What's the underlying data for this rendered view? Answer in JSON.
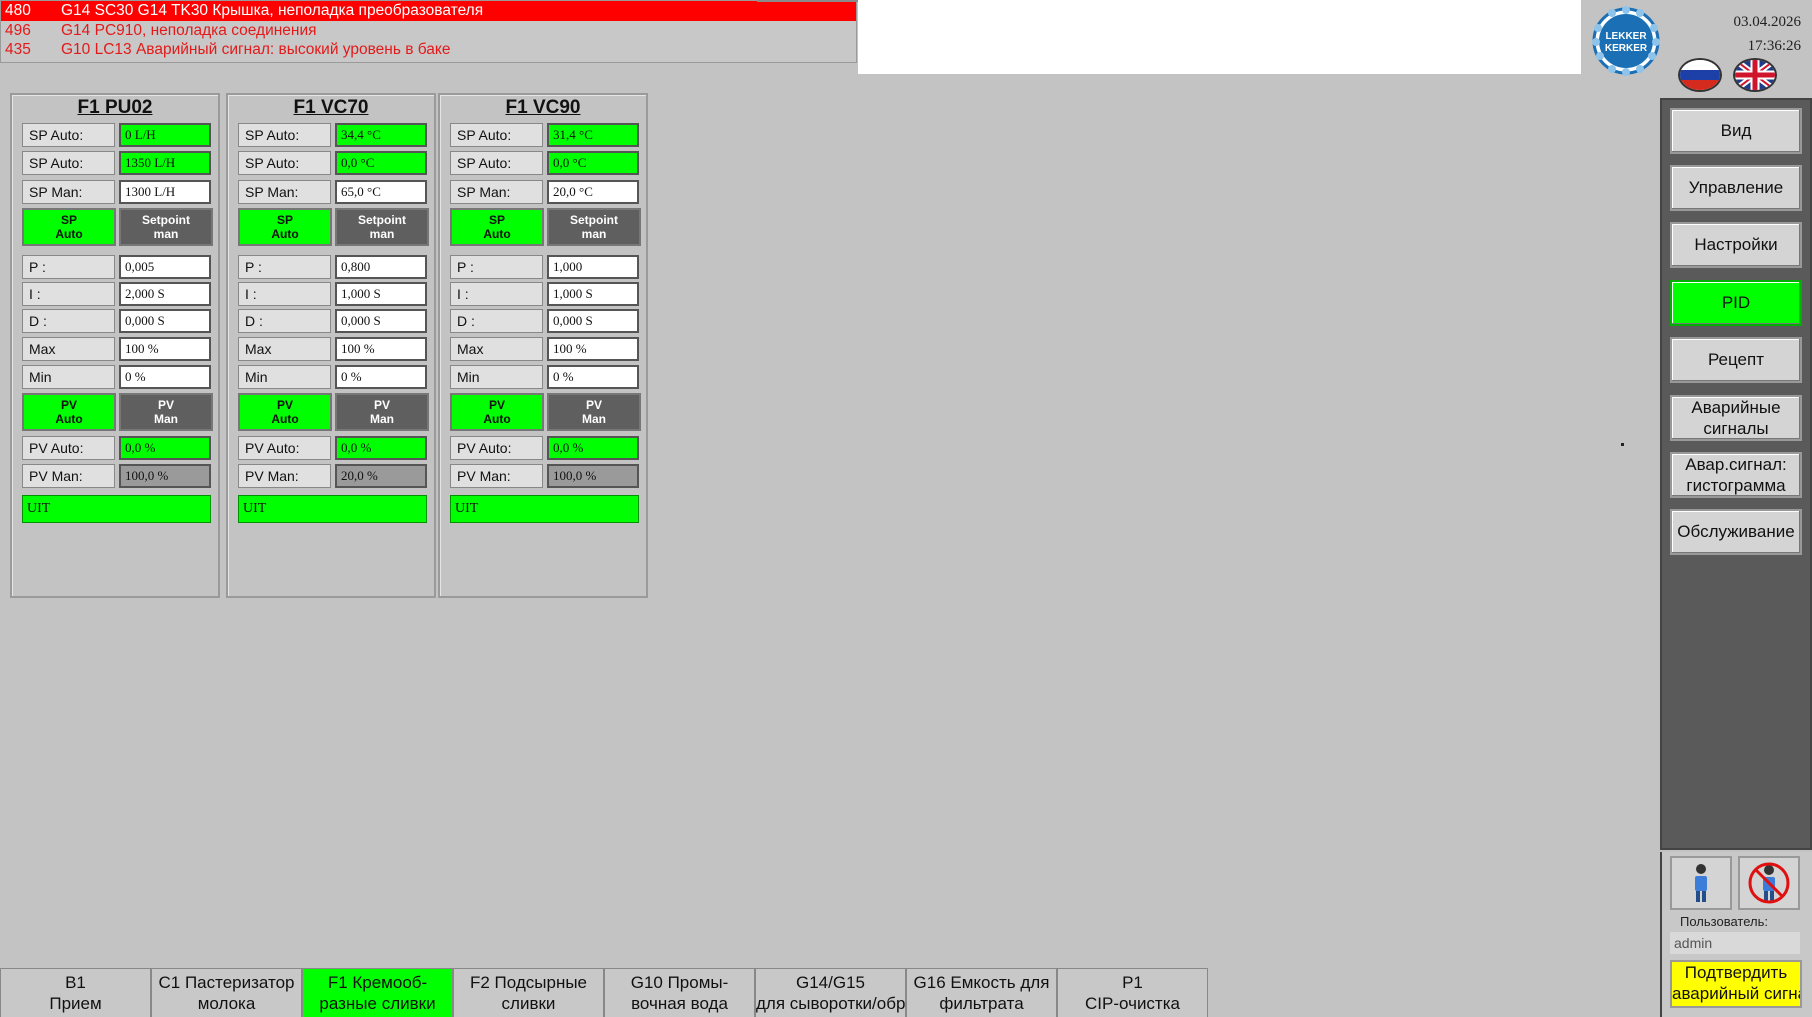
{
  "alarms": [
    {
      "num": "480",
      "text": "G14 SC30 G14 TK30 Крышка, неполадка преобразователя",
      "active": true
    },
    {
      "num": "496",
      "text": "G14 PC910, неполадка соединения",
      "active": false
    },
    {
      "num": "435",
      "text": "G10 LC13 Аварийный сигнал: высокий уровень в баке",
      "active": false
    }
  ],
  "header": {
    "logo_top": "LEKKER",
    "logo_bottom": "KERKER",
    "date": "03.04.2026",
    "time": "17:36:26"
  },
  "nav": [
    {
      "label": "Вид",
      "active": false
    },
    {
      "label": "Управление",
      "active": false
    },
    {
      "label": "Настройки",
      "active": false
    },
    {
      "label": "PID",
      "active": true
    },
    {
      "label": "Рецепт",
      "active": false
    },
    {
      "label": "Аварийные сигналы",
      "active": false
    },
    {
      "label": "Авар.сигнал: гистограмма",
      "active": false
    },
    {
      "label": "Обслуживание",
      "active": false
    }
  ],
  "user": {
    "label": "Пользователь:",
    "value": "admin",
    "ack_line1": "Подтвердить",
    "ack_line2": "аварийный сигнал"
  },
  "panels": [
    {
      "title": "F1 PU02",
      "sp_auto_label": "SP Auto:",
      "sp_auto_1": "0 L/H",
      "sp_auto_label_2": "SP Auto:",
      "sp_auto_2": "1350 L/H",
      "sp_man_label": "SP Man:",
      "sp_man": "1300 L/H",
      "btn_sp_auto": "SP\nAuto",
      "btn_setpoint_man": "Setpoint\nman",
      "p_label": "P :",
      "p": "0,005",
      "i_label": "I :",
      "i": "2,000 S",
      "d_label": "D :",
      "d": "0,000 S",
      "max_label": "Max",
      "max": "100 %",
      "min_label": "Min",
      "min": "0 %",
      "btn_pv_auto": "PV\nAuto",
      "btn_pv_man": "PV\nMan",
      "pv_auto_label": "PV Auto:",
      "pv_auto": "0,0 %",
      "pv_man_label": "PV Man:",
      "pv_man": "100,0 %",
      "uit": "UIT"
    },
    {
      "title": "F1 VC70",
      "sp_auto_label": "SP Auto:",
      "sp_auto_1": "34,4 °C",
      "sp_auto_label_2": "SP Auto:",
      "sp_auto_2": "0,0 °C",
      "sp_man_label": "SP Man:",
      "sp_man": "65,0 °C",
      "btn_sp_auto": "SP\nAuto",
      "btn_setpoint_man": "Setpoint\nman",
      "p_label": "P :",
      "p": "0,800",
      "i_label": "I :",
      "i": "1,000 S",
      "d_label": "D :",
      "d": "0,000 S",
      "max_label": "Max",
      "max": "100 %",
      "min_label": "Min",
      "min": "0 %",
      "btn_pv_auto": "PV\nAuto",
      "btn_pv_man": "PV\nMan",
      "pv_auto_label": "PV Auto:",
      "pv_auto": "0,0 %",
      "pv_man_label": "PV Man:",
      "pv_man": "20,0 %",
      "uit": "UIT"
    },
    {
      "title": "F1 VC90",
      "sp_auto_label": "SP Auto:",
      "sp_auto_1": "31,4 °C",
      "sp_auto_label_2": "SP Auto:",
      "sp_auto_2": "0,0 °C",
      "sp_man_label": "SP Man:",
      "sp_man": "20,0 °C",
      "btn_sp_auto": "SP\nAuto",
      "btn_setpoint_man": "Setpoint\nman",
      "p_label": "P :",
      "p": "1,000",
      "i_label": "I :",
      "i": "1,000 S",
      "d_label": "D :",
      "d": "0,000 S",
      "max_label": "Max",
      "max": "100 %",
      "min_label": "Min",
      "min": "0 %",
      "btn_pv_auto": "PV\nAuto",
      "btn_pv_man": "PV\nMan",
      "pv_auto_label": "PV Auto:",
      "pv_auto": "0,0 %",
      "pv_man_label": "PV Man:",
      "pv_man": "100,0 %",
      "uit": "UIT"
    }
  ],
  "tabs": [
    {
      "line1": "B1",
      "line2": "Прием",
      "active": false
    },
    {
      "line1": "C1 Пастеризатор",
      "line2": "молока",
      "active": false
    },
    {
      "line1": "F1 Кремооб-",
      "line2": "разные сливки",
      "active": true
    },
    {
      "line1": "F2 Подсырные",
      "line2": "сливки",
      "active": false
    },
    {
      "line1": "G10 Промы-",
      "line2": "вочная вода",
      "active": false
    },
    {
      "line1": "G14/G15",
      "line2": "для сыворотки/обр",
      "active": false
    },
    {
      "line1": "G16 Емкость для",
      "line2": "фильтрата",
      "active": false
    },
    {
      "line1": "P1",
      "line2": "CIP-очистка",
      "active": false
    }
  ],
  "colors": {
    "alarm_active_bg": "#ff0000",
    "alarm_text": "#e31a1a",
    "status_green": "#00ff00",
    "ack_yellow": "#ffff00",
    "background": "#c3c3c3"
  }
}
